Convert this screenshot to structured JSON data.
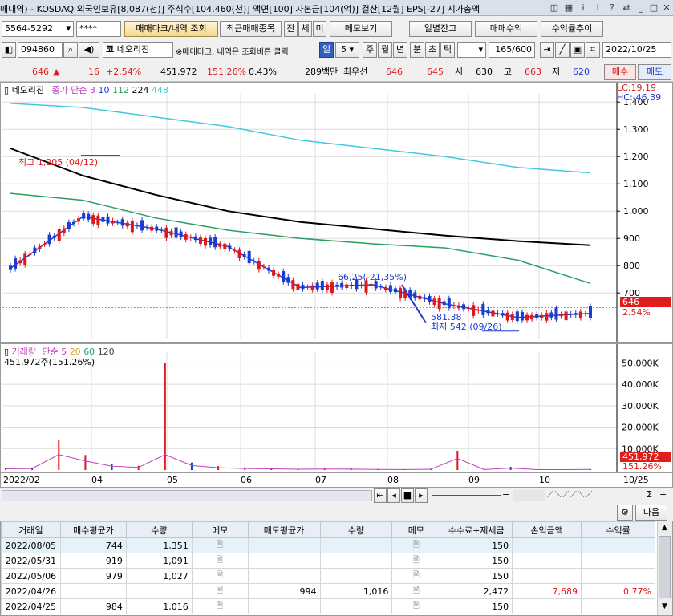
{
  "title_bar": {
    "text": "매내역) - KOSDAQ 외국인보유[8,087(천)] 주식수[104,460(천)] 액면[100] 자본금[104(억)] 결산[12월] EPS[-27] 시가총액"
  },
  "toolbar1": {
    "account": "5564-5292",
    "password": "****",
    "btn_marks": "매매마크/내역 조회",
    "btn_recent": "최근매매종목",
    "btn_jan": "잔",
    "btn_che": "체",
    "btn_mi": "미",
    "btn_memo": "메모보기",
    "btn_daily": "일별잔고",
    "btn_trade_profit": "매매수익",
    "btn_return_trend": "수익률추이"
  },
  "toolbar2": {
    "code": "094860",
    "market_tag": "코",
    "stock_name": "네오리진",
    "hint": "※매매마크, 내역은 조회버튼 클릭",
    "periods": [
      "일",
      "5",
      "주",
      "월",
      "년",
      "분",
      "초",
      "틱"
    ],
    "count": "165",
    "count_max": "/600",
    "date": "2022/10/25"
  },
  "quote": {
    "price": "646",
    "change": "16",
    "pct": "+2.54%",
    "volume": "451,972",
    "vol_ratio": "151.26%",
    "turnover": "0.43%",
    "amount": "289백만",
    "best_bid_label": "최우선",
    "bid1": "646",
    "bid2": "645",
    "open_label": "시",
    "open": "630",
    "high_label": "고",
    "high": "663",
    "low_label": "저",
    "low": "620",
    "buy_btn": "매수",
    "sell_btn": "매도"
  },
  "price_panel": {
    "legend_name": "네오리진",
    "legend_ma": "종가 단순",
    "ma_periods": [
      "3",
      "10",
      "112",
      "224",
      "448"
    ],
    "lc": "LC:19.19",
    "hc": "HC:-46.39",
    "high_note": "최고 1,205 (04/12)",
    "low_note": "최저 542 (09/26)",
    "line_label1": "66,25(-21,35%)",
    "line_label2": "581.38",
    "cur_price": "646",
    "cur_pct": "2.54%"
  },
  "volume_panel": {
    "legend_name": "거래량",
    "legend_ma": "단순",
    "ma_periods": [
      "5",
      "20",
      "60",
      "120"
    ],
    "value_note": "451,972주(151.26%)",
    "cur_vol": "451,972",
    "cur_pct": "151.26%"
  },
  "x_axis": {
    "labels": [
      "2022/02",
      "04",
      "05",
      "06",
      "07",
      "08",
      "09",
      "10",
      "10/25"
    ]
  },
  "chart_data": [
    {
      "type": "line",
      "title": "네오리진",
      "ylabel": "",
      "ylim": [
        530,
        1430
      ],
      "y_ticks": [
        1400,
        1300,
        1200,
        1100,
        1000,
        900,
        800,
        700
      ],
      "y_tick_labels": [
        "1,400",
        "1,300",
        "1,200",
        "1,100",
        "1,000",
        "900",
        "800",
        "700"
      ],
      "x": [
        "2022/02",
        "04",
        "05",
        "06",
        "07",
        "08",
        "09",
        "10",
        "10/25"
      ],
      "series": [
        {
          "name": "448",
          "color": "#40c8e0",
          "values": [
            1395,
            1380,
            1345,
            1310,
            1260,
            1230,
            1200,
            1160,
            1140
          ]
        },
        {
          "name": "224",
          "color": "#000000",
          "values": [
            1230,
            1130,
            1060,
            1000,
            960,
            935,
            910,
            890,
            875
          ]
        },
        {
          "name": "112",
          "color": "#28a060",
          "values": [
            1065,
            1040,
            975,
            930,
            900,
            880,
            865,
            820,
            735
          ]
        },
        {
          "name": "10",
          "color": "#1c3cd0",
          "values": [
            790,
            980,
            935,
            870,
            720,
            730,
            660,
            610,
            625
          ]
        }
      ],
      "highlights": {
        "high": 1205,
        "low": 542,
        "current": 646
      }
    },
    {
      "type": "bar",
      "title": "거래량",
      "ylim": [
        0,
        55000
      ],
      "y_ticks": [
        50000,
        40000,
        30000,
        20000,
        10000
      ],
      "y_tick_labels": [
        "50,000K",
        "40,000K",
        "30,000K",
        "20,000K",
        "10,000K"
      ],
      "values_k": [
        900,
        1200,
        14000,
        7000,
        3000,
        2000,
        50000,
        3500,
        1800,
        1200,
        900,
        600,
        800,
        700,
        500,
        400,
        600,
        9000,
        400,
        1500,
        350,
        300,
        452
      ]
    }
  ],
  "chart_controls": {
    "minus": "−",
    "plus": "+",
    "sigma": "Σ",
    "next": "다음"
  },
  "table": {
    "headers": [
      "거래일",
      "매수평균가",
      "수량",
      "메모",
      "매도평균가",
      "수량",
      "메모",
      "수수료+제세금",
      "손익금액",
      "수익률"
    ],
    "rows": [
      {
        "date": "2022/08/05",
        "buy_avg": "744",
        "buy_qty": "1,351",
        "sell_avg": "",
        "sell_qty": "",
        "fee": "150",
        "pnl": "",
        "ret": ""
      },
      {
        "date": "2022/05/31",
        "buy_avg": "919",
        "buy_qty": "1,091",
        "sell_avg": "",
        "sell_qty": "",
        "fee": "150",
        "pnl": "",
        "ret": ""
      },
      {
        "date": "2022/05/06",
        "buy_avg": "979",
        "buy_qty": "1,027",
        "sell_avg": "",
        "sell_qty": "",
        "fee": "150",
        "pnl": "",
        "ret": ""
      },
      {
        "date": "2022/04/26",
        "buy_avg": "",
        "buy_qty": "",
        "sell_avg": "994",
        "sell_qty": "1,016",
        "fee": "2,472",
        "pnl": "7,689",
        "ret": "0.77%"
      },
      {
        "date": "2022/04/25",
        "buy_avg": "984",
        "buy_qty": "1,016",
        "sell_avg": "",
        "sell_qty": "",
        "fee": "150",
        "pnl": "",
        "ret": ""
      }
    ]
  }
}
